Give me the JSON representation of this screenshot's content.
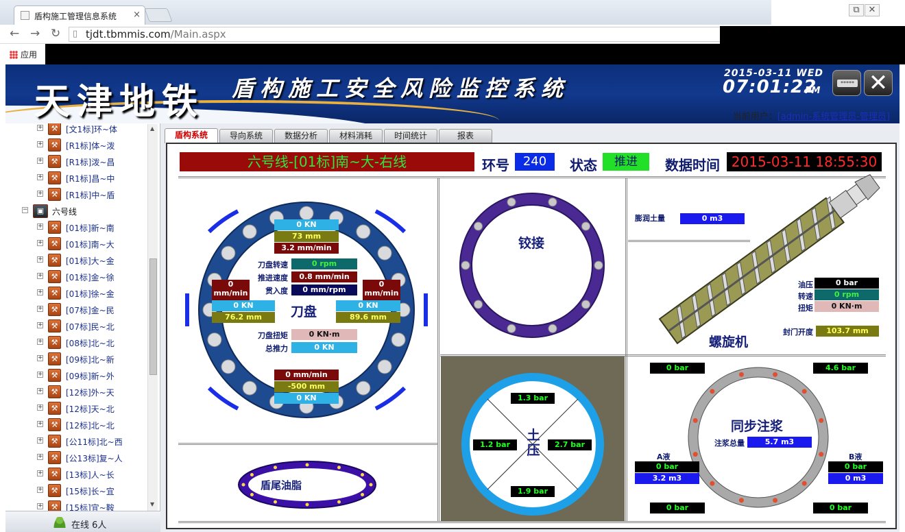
{
  "browser": {
    "tab_title": "盾构施工管理信息系统",
    "tab_close": "×",
    "url_host": "tjdt.tbmmis.com",
    "url_path": "/Main.aspx",
    "apps_label": "应用",
    "window_buttons": [
      "⧉",
      "✕"
    ]
  },
  "header": {
    "logo_text": "天津地铁",
    "system_title": "盾构施工安全风险监控系统",
    "clock_date": "2015-03-11  WED",
    "clock_time": "07:01:22",
    "clock_ampm": "PM",
    "lock_button_text": "*****",
    "close_button_text": "✕"
  },
  "user": {
    "prefix": "当前用户：",
    "name": "[admin-系统管理员-管理员]"
  },
  "tree": {
    "items": [
      {
        "label": "[文1标]环~体",
        "type": "site"
      },
      {
        "label": "[R1标]体~泼",
        "type": "site"
      },
      {
        "label": "[R1标]泼~昌",
        "type": "site"
      },
      {
        "label": "[R1标]昌~中",
        "type": "site"
      },
      {
        "label": "[R1标]中~盾",
        "type": "site"
      },
      {
        "label": "六号线",
        "type": "line"
      },
      {
        "label": "[01标]新~南",
        "type": "site"
      },
      {
        "label": "[01标]南~大",
        "type": "site"
      },
      {
        "label": "[01标]大~金",
        "type": "site"
      },
      {
        "label": "[01标]金~徐",
        "type": "site"
      },
      {
        "label": "[01标]徐~金",
        "type": "site"
      },
      {
        "label": "[07标]金~民",
        "type": "site"
      },
      {
        "label": "[07标]民~北",
        "type": "site"
      },
      {
        "label": "[08标]北~北",
        "type": "site"
      },
      {
        "label": "[09标]北~新",
        "type": "site"
      },
      {
        "label": "[09标]新~外",
        "type": "site"
      },
      {
        "label": "[12标]外~天",
        "type": "site"
      },
      {
        "label": "[12标]天~北",
        "type": "site"
      },
      {
        "label": "[12标]北~北",
        "type": "site"
      },
      {
        "label": "[公11标]北~西",
        "type": "site"
      },
      {
        "label": "[公13标]复~人",
        "type": "site"
      },
      {
        "label": "[13标]人~长",
        "type": "site"
      },
      {
        "label": "[15标]长~宜",
        "type": "site"
      },
      {
        "label": "[15标]宜~鞍",
        "type": "site"
      }
    ],
    "online_text": "在线 6人"
  },
  "tabs": [
    "盾构系统",
    "导向系统",
    "数据分析",
    "材料消耗",
    "时间统计",
    "报表"
  ],
  "status": {
    "line_name": "六号线-[01标]南~大-右线",
    "ring_label": "环号",
    "ring_value": "240",
    "state_label": "状态",
    "state_value": "推进",
    "data_time_label": "数据时间",
    "data_time_value": "2015-03-11 18:55:30"
  },
  "cutter": {
    "title": "刀盘",
    "top_stack": [
      "0 KN",
      "73 mm",
      "3.2 mm/min"
    ],
    "speed_label": "刀盘转速",
    "speed_value": "0 rpm",
    "advance_label": "推进速度",
    "advance_value": "0.8 mm/min",
    "penetration_label": "贯入度",
    "penetration_value": "0 mm/rpm",
    "torque_label": "刀盘扭矩",
    "torque_value": "0 KN·m",
    "thrust_label": "总推力",
    "thrust_value": "0 KN",
    "left_speed": "0\nmm/min",
    "left_force": "0 KN",
    "left_disp": "76.2 mm",
    "right_speed": "0\nmm/min",
    "right_force": "0 KN",
    "right_disp": "89.6 mm",
    "bottom_stack": [
      "0 mm/min",
      "-500 mm",
      "0 KN"
    ]
  },
  "hinge": {
    "title": "铰接"
  },
  "screw": {
    "title": "螺旋机",
    "bentonite_label": "膨润土量",
    "bentonite_value": "0 m3",
    "oil_label": "油压",
    "oil_value": "0 bar",
    "speed_label": "转速",
    "speed_value": "0 rpm",
    "torque_label": "扭矩",
    "torque_value": "0 KN·m",
    "gate_label": "封门开度",
    "gate_value": "103.7 mm"
  },
  "tail": {
    "title": "盾尾油脂"
  },
  "earth": {
    "title": "土压",
    "top": "1.3 bar",
    "left": "1.2 bar",
    "right": "2.7 bar",
    "bottom": "1.9 bar"
  },
  "grout": {
    "title": "同步注浆",
    "total_label": "注浆总量",
    "total_value": "5.7 m3",
    "tl": "0 bar",
    "tr": "4.6 bar",
    "bl": "0 bar",
    "br": "0 bar",
    "a_label": "A液",
    "a_pressure": "0 bar",
    "a_volume": "3.2 m3",
    "b_label": "B液",
    "b_pressure": "0 bar",
    "b_volume": "0 m3"
  }
}
